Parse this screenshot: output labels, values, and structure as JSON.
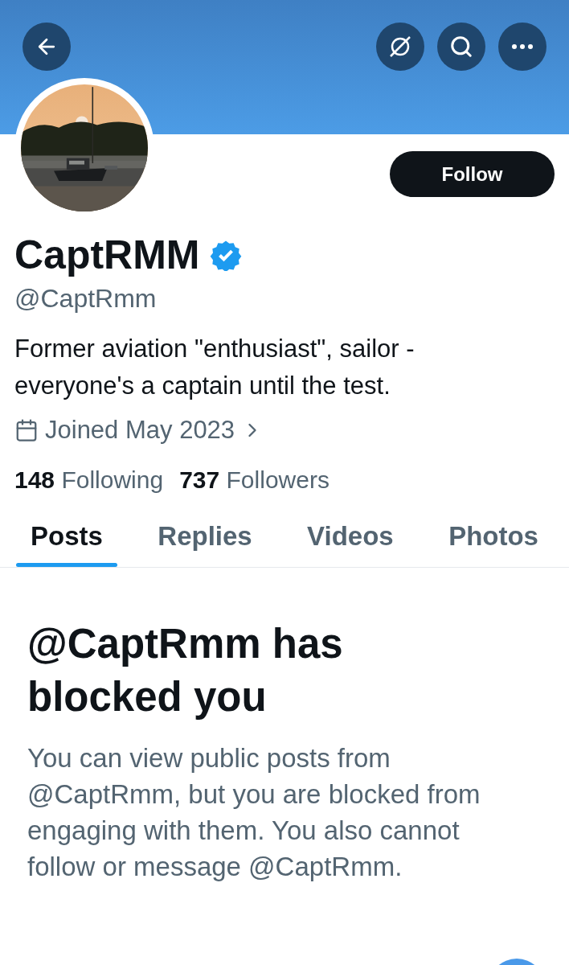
{
  "profile": {
    "name": "CaptRMM",
    "verified": true,
    "handle": "@CaptRmm",
    "bio": "Former aviation \"enthusiast\", sailor - everyone's a captain until the test.",
    "joined": "Joined May 2023",
    "following_count": "148",
    "following_label": "Following",
    "followers_count": "737",
    "followers_label": "Followers"
  },
  "follow_button": "Follow",
  "tabs": [
    {
      "label": "Posts",
      "selected": true
    },
    {
      "label": "Replies",
      "selected": false
    },
    {
      "label": "Videos",
      "selected": false
    },
    {
      "label": "Photos",
      "selected": false
    }
  ],
  "notice": {
    "title": "@CaptRmm has blocked you",
    "body": "You can view public posts from @CaptRmm, but you are blocked from engaging with them. You also cannot follow or message @CaptRmm."
  }
}
